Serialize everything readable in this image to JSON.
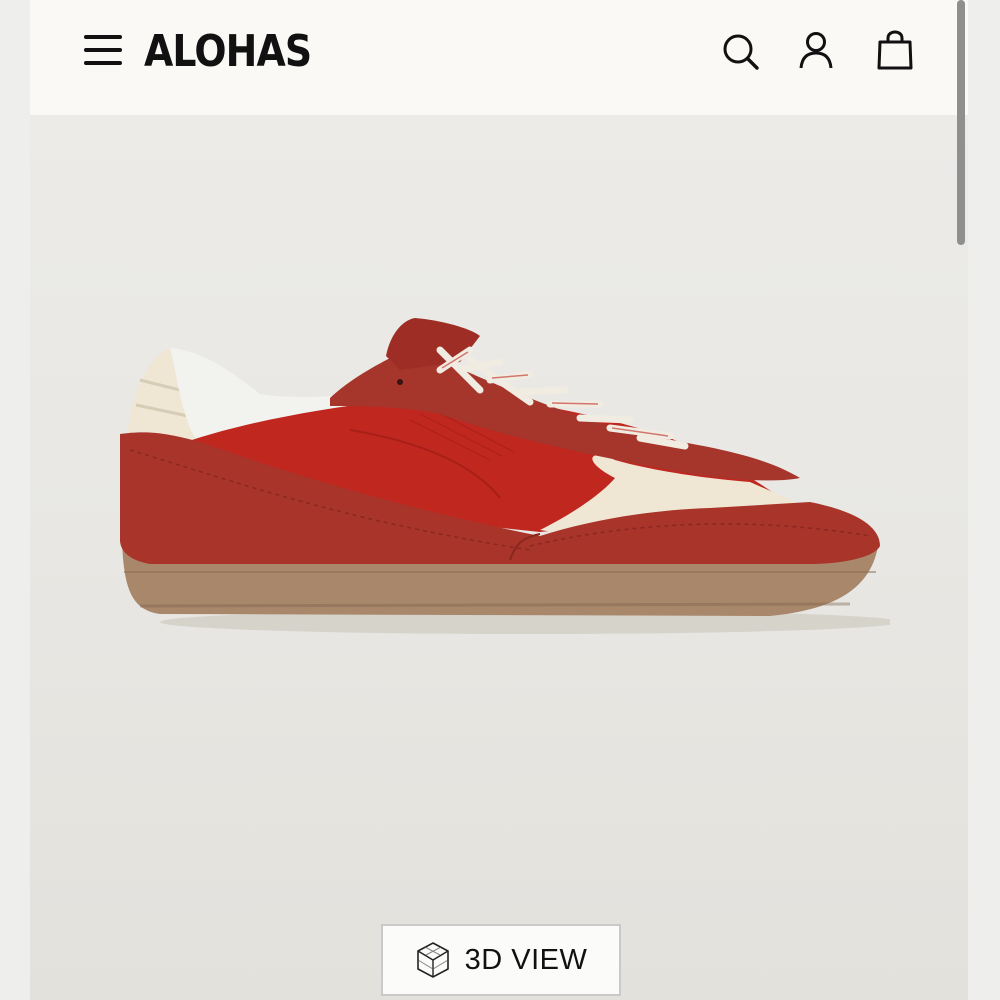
{
  "header": {
    "logo": "ALOHAS",
    "menu_icon": "hamburger-menu-icon",
    "search_icon": "search-icon",
    "account_icon": "user-icon",
    "bag_icon": "shopping-bag-icon"
  },
  "product": {
    "image_alt_icon": "red-suede-sneaker",
    "view_3d_label": "3D VIEW",
    "view_3d_icon": "cube-3d-icon"
  },
  "colors": {
    "shoe_red": "#c0271f",
    "suede": "#a8342a",
    "sole": "#a9876b",
    "cream": "#efe6d4"
  }
}
